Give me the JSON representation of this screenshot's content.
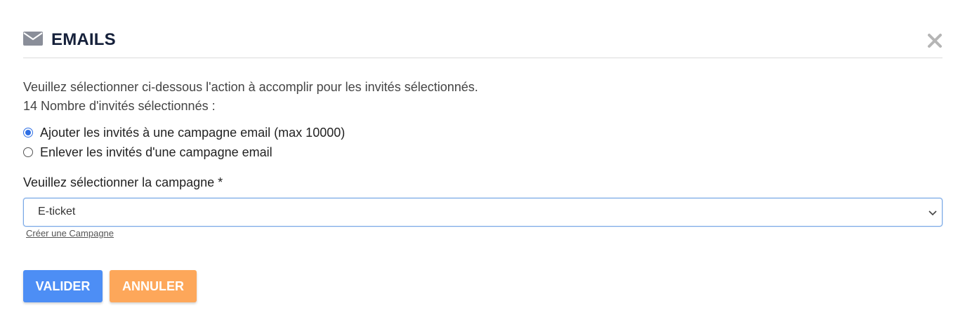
{
  "header": {
    "title": "EMAILS",
    "icon": "envelope-icon",
    "close_icon": "close-icon"
  },
  "intro": {
    "line1": "Veuillez sélectionner ci-dessous l'action à accomplir pour les invités sélectionnés.",
    "line2": "14 Nombre d'invités sélectionnés :"
  },
  "options": [
    {
      "label": "Ajouter les invités à une campagne email (max 10000)",
      "checked": true
    },
    {
      "label": "Enlever les invités d'une campagne email",
      "checked": false
    }
  ],
  "campaign": {
    "label": "Veuillez sélectionner la campagne *",
    "selected": "E-ticket",
    "create_link": "Créer une Campagne"
  },
  "buttons": {
    "validate": "VALIDER",
    "cancel": "ANNULER"
  },
  "colors": {
    "title": "#15203a",
    "primary": "#4d8ef5",
    "warning": "#fda75a",
    "radio": "#2f6fe4"
  }
}
